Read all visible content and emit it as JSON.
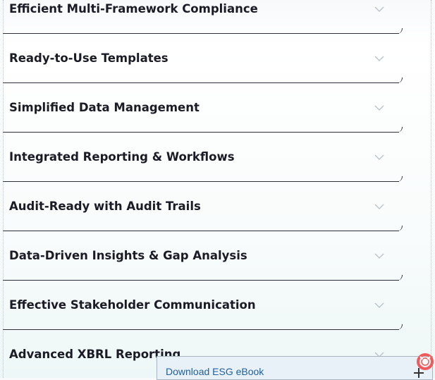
{
  "accordion": {
    "items": [
      {
        "title": "Efficient Multi-Framework Compliance"
      },
      {
        "title": "Ready-to-Use Templates"
      },
      {
        "title": "Simplified Data Management"
      },
      {
        "title": "Integrated Reporting & Workflows"
      },
      {
        "title": "Audit-Ready with Audit Trails"
      },
      {
        "title": "Data-Driven Insights & Gap Analysis"
      },
      {
        "title": "Effective Stakeholder Communication"
      },
      {
        "title": "Advanced XBRL Reporting"
      }
    ],
    "icon": "chevron-down-icon"
  },
  "ebook": {
    "label": "Download ESG eBook",
    "icon": "plus-icon"
  },
  "help_widget": {
    "icon": "help-lifebuoy-icon",
    "color": "#f05a5a"
  },
  "colors": {
    "title": "#1b1b26",
    "link": "#1f5f9e",
    "chevron": "#b8c0c8"
  }
}
